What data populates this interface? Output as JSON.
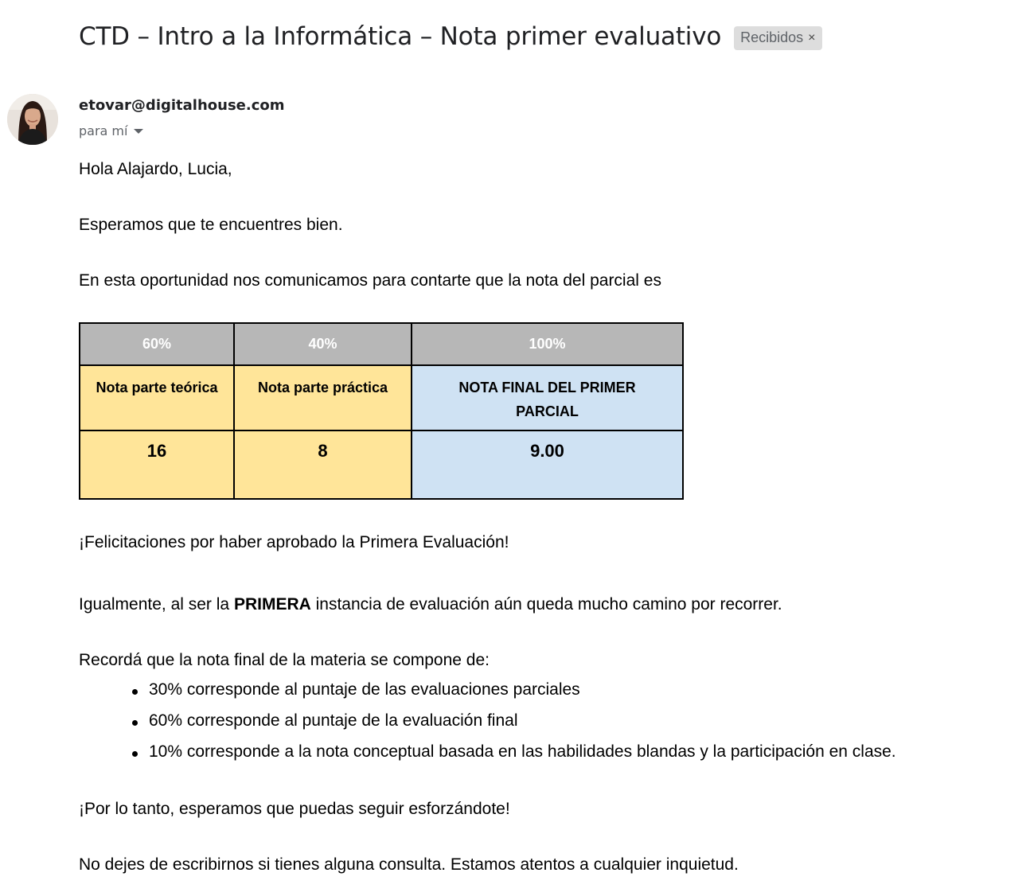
{
  "email": {
    "subject": "CTD – Intro a la Informática – Nota primer evaluativo",
    "label": "Recibidos",
    "label_remove": "×",
    "sender": "etovar@digitalhouse.com",
    "recipient": "para mí"
  },
  "body": {
    "greeting": "Hola Alajardo, Lucia,",
    "line1": "Esperamos que te encuentres bien.",
    "line2": "En esta oportunidad nos comunicamos para contarte que la nota del parcial es",
    "congrats": "¡Felicitaciones por haber aprobado la Primera Evaluación!",
    "line3_pre": "Igualmente, al ser la ",
    "line3_bold": "PRIMERA",
    "line3_post": " instancia de evaluación aún queda mucho camino por recorrer.",
    "reminder": "Recordá que la nota final de la materia se compone de:",
    "bullets": [
      "30% corresponde al puntaje de las evaluaciones parciales",
      "60% corresponde al puntaje de la evaluación final",
      "10% corresponde a la nota conceptual basada en las habilidades blandas y la participación en clase."
    ],
    "encourage": "¡Por lo tanto, esperamos que puedas seguir esforzándote!",
    "closing": "No dejes de escribirnos si tienes alguna consulta. Estamos atentos a cualquier inquietud."
  },
  "grades_table": {
    "weights": [
      "60%",
      "40%",
      "100%"
    ],
    "headers": [
      "Nota parte teórica",
      "Nota parte práctica",
      "NOTA FINAL DEL PRIMER PARCIAL"
    ],
    "values": [
      "16",
      "8",
      "9.00"
    ],
    "colors": {
      "weight_bg": "#b7b7b7",
      "yellow": "#ffe599",
      "blue": "#cfe2f3"
    }
  }
}
